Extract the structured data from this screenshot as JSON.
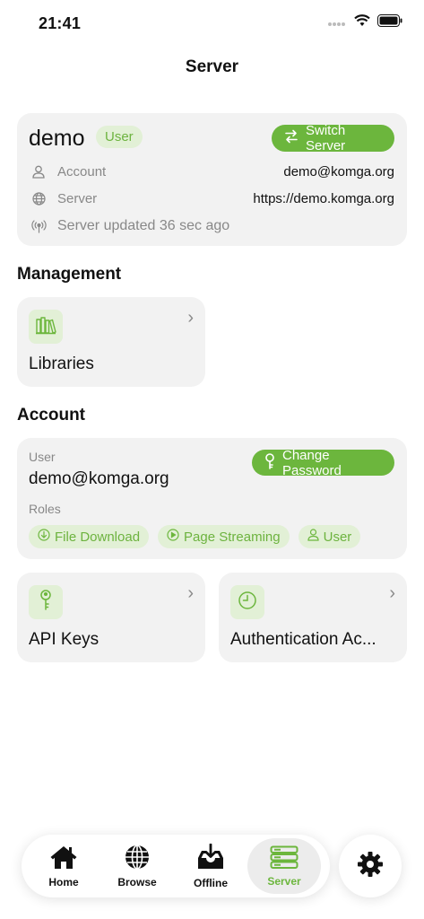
{
  "status": {
    "time": "21:41"
  },
  "header": {
    "title": "Server"
  },
  "server_card": {
    "name": "demo",
    "role_badge": "User",
    "switch_button": "Switch Server",
    "account_label": "Account",
    "account_value": "demo@komga.org",
    "server_label": "Server",
    "server_value": "https://demo.komga.org",
    "updated_text": "Server updated 36 sec ago"
  },
  "management": {
    "title": "Management",
    "libraries_label": "Libraries"
  },
  "account": {
    "title": "Account",
    "user_label": "User",
    "user_value": "demo@komga.org",
    "change_password_button": "Change Password",
    "roles_label": "Roles",
    "roles": [
      "File Download",
      "Page Streaming",
      "User"
    ],
    "api_keys_label": "API Keys",
    "auth_activity_label": "Authentication Ac..."
  },
  "tabbar": {
    "tabs": [
      {
        "label": "Home",
        "icon": "house-icon"
      },
      {
        "label": "Browse",
        "icon": "globe-icon"
      },
      {
        "label": "Offline",
        "icon": "tray-download-icon"
      },
      {
        "label": "Server",
        "icon": "server-icon"
      }
    ],
    "active": "Server",
    "settings_icon": "gear-icon"
  },
  "colors": {
    "accent": "#6cb63d",
    "accent_soft": "#e2f0d6",
    "card": "#f2f2f2"
  }
}
